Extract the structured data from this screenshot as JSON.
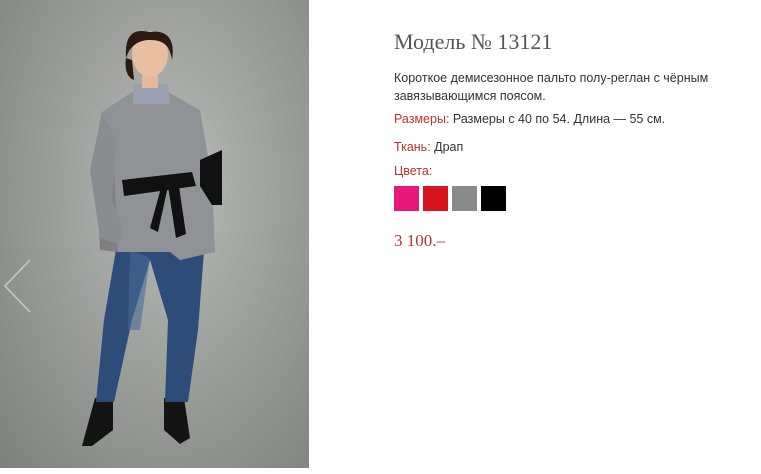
{
  "product": {
    "title": "Модель № 13121",
    "description": "Короткое демисезонное пальто полу-реглан с чёрным завязывающимся поясом.",
    "sizes_label": "Размеры:",
    "sizes_value": " Размеры с 40 по 54. Длина — 55 см.",
    "fabric_label": "Ткань:",
    "fabric_value": " Драп",
    "colors_label": "Цвета:",
    "colors": [
      {
        "name": "pink",
        "hex": "#e8187a"
      },
      {
        "name": "red",
        "hex": "#d8141e"
      },
      {
        "name": "gray",
        "hex": "#8a8a8a"
      },
      {
        "name": "black",
        "hex": "#000000"
      }
    ],
    "price": "3 100.–"
  },
  "gallery": {
    "prev_icon": "chevron-left-icon"
  }
}
